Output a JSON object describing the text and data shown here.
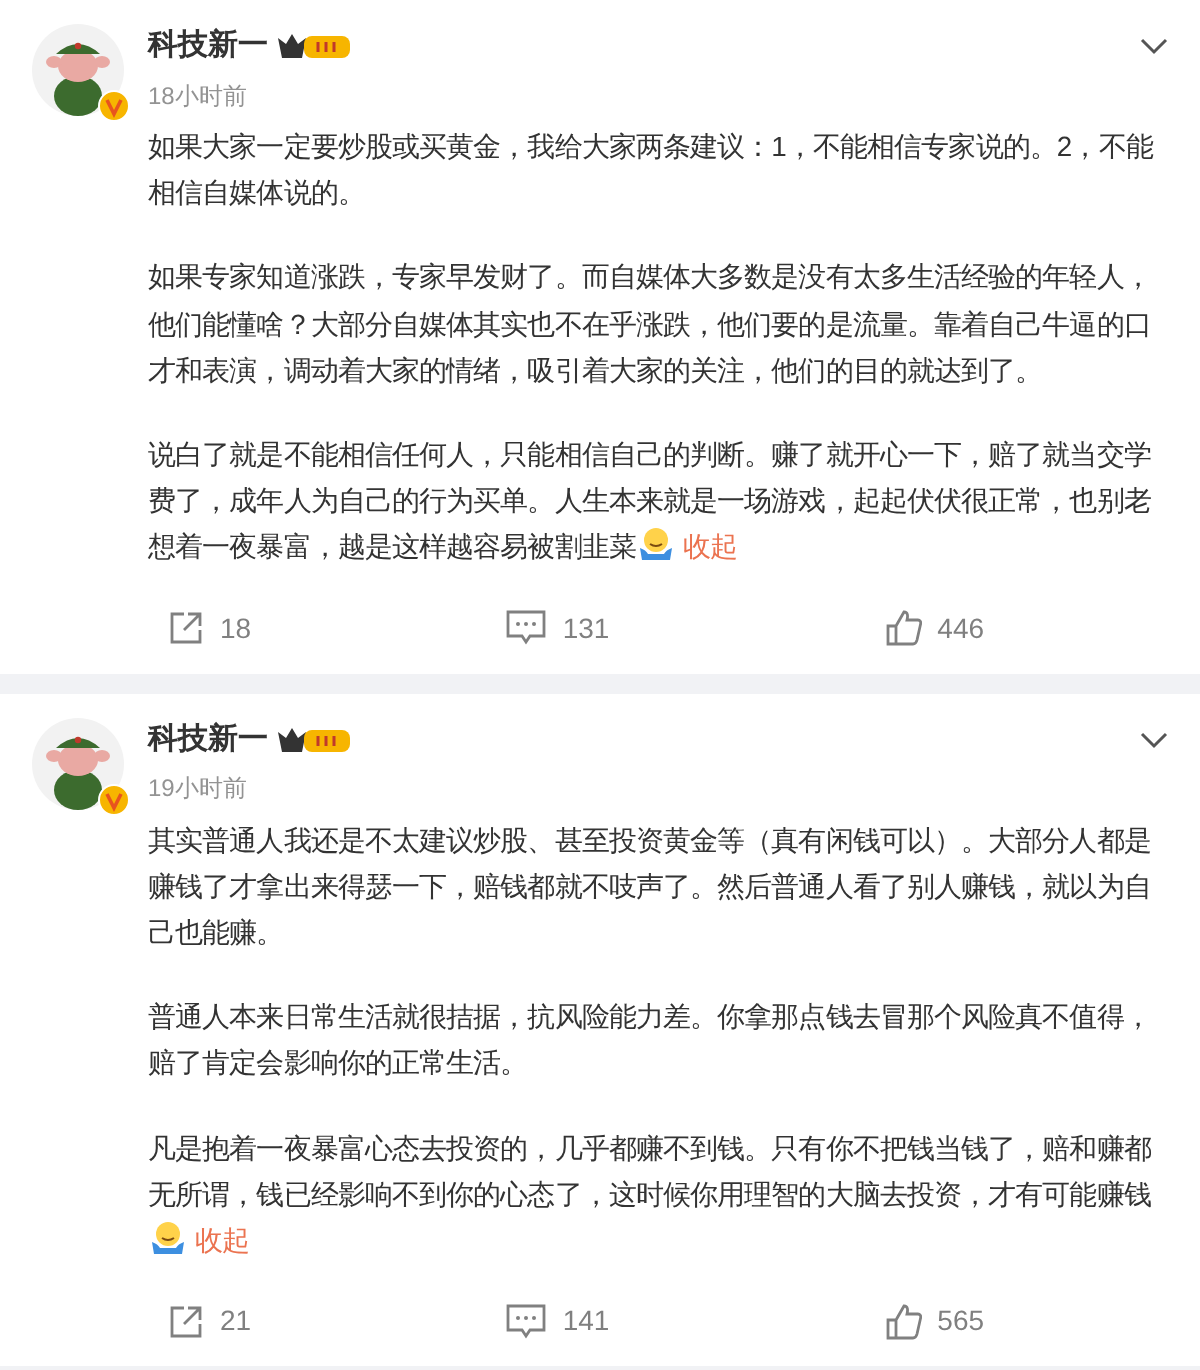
{
  "posts": [
    {
      "author": "科技新一",
      "time": "18小时前",
      "paragraphs": [
        "如果大家一定要炒股或买黄金，我给大家两条建议：1，不能相信专家说的。2，不能相信自媒体说的。",
        "如果专家知道涨跌，专家早发财了。而自媒体大多数是没有太多生活经验的年轻人，他们能懂啥？大部分自媒体其实也不在乎涨跌，他们要的是流量。靠着自己牛逼的口才和表演，调动着大家的情绪，吸引着大家的关注，他们的目的就达到了。",
        "说白了就是不能相信任何人，只能相信自己的判断。赚了就开心一下，赔了就当交学费了，成年人为自己的行为买单。人生本来就是一场游戏，起起伏伏很正常，也别老想着一夜暴富，越是这样越容易被割韭菜"
      ],
      "collapse": "收起",
      "reposts": "18",
      "comments": "131",
      "likes": "446"
    },
    {
      "author": "科技新一",
      "time": "19小时前",
      "paragraphs": [
        "其实普通人我还是不太建议炒股、甚至投资黄金等（真有闲钱可以）。大部分人都是赚钱了才拿出来得瑟一下，赔钱都就不吱声了。然后普通人看了别人赚钱，就以为自己也能赚。",
        "普通人本来日常生活就很拮据，抗风险能力差。你拿那点钱去冒那个风险真不值得，赔了肯定会影响你的正常生活。",
        "凡是抱着一夜暴富心态去投资的，几乎都赚不到钱。只有你不把钱当钱了，赔和赚都无所谓，钱已经影响不到你的心态了，这时候你用理智的大脑去投资，才有可能赚钱"
      ],
      "collapse": "收起",
      "reposts": "21",
      "comments": "141",
      "likes": "565"
    }
  ]
}
